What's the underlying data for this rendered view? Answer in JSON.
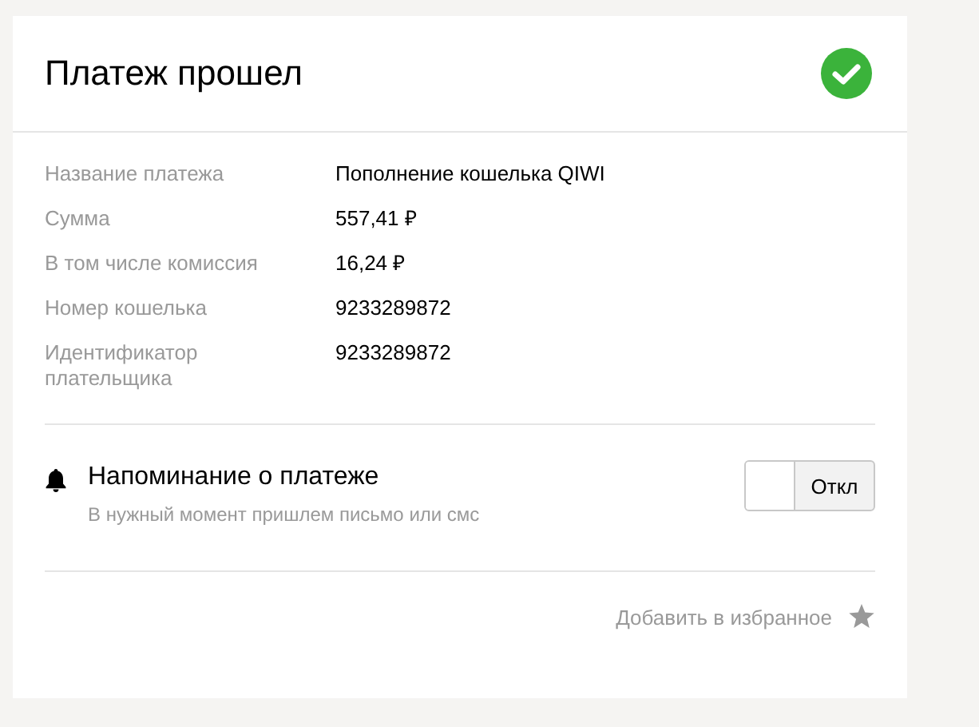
{
  "header": {
    "title": "Платеж прошел",
    "success": true
  },
  "details": [
    {
      "label": "Название платежа",
      "value": "Пополнение кошелька QIWI"
    },
    {
      "label": "Сумма",
      "value": "557,41 ₽"
    },
    {
      "label": "В том числе комиссия",
      "value": "16,24 ₽"
    },
    {
      "label": "Номер кошелька",
      "value": "9233289872"
    },
    {
      "label": "Идентификатор плательщика",
      "value": "9233289872"
    }
  ],
  "reminder": {
    "title": "Напоминание о платеже",
    "subtitle": "В нужный момент пришлем письмо или смс",
    "on": false,
    "toggle_label": "Откл"
  },
  "favorite": {
    "label": "Добавить в избранное"
  }
}
